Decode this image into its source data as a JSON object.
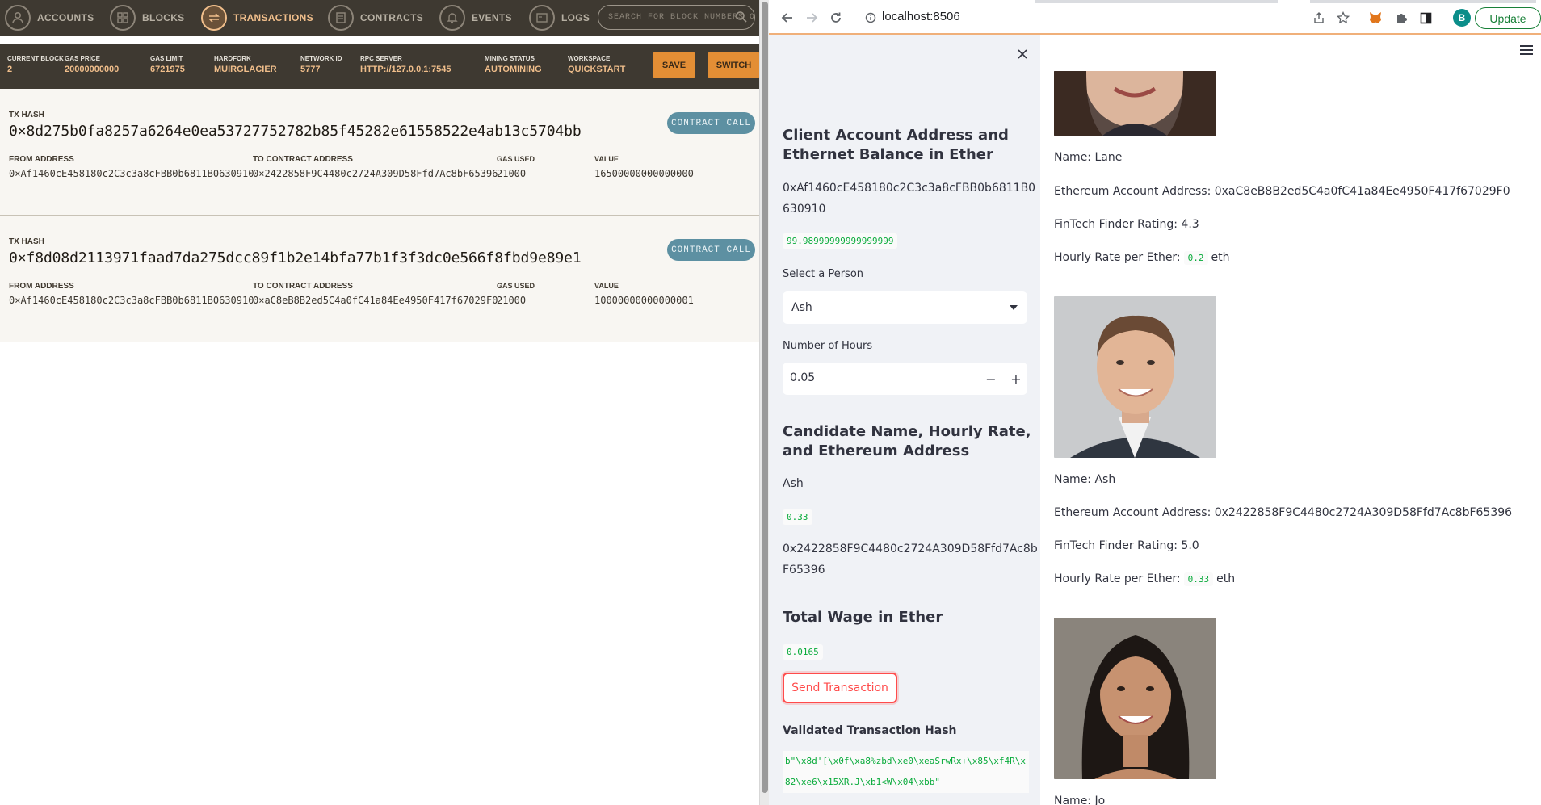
{
  "ganache": {
    "nav": [
      {
        "label": "ACCOUNTS",
        "icon": "user-icon",
        "active": false
      },
      {
        "label": "BLOCKS",
        "icon": "blocks-icon",
        "active": false
      },
      {
        "label": "TRANSACTIONS",
        "icon": "transactions-icon",
        "active": true
      },
      {
        "label": "CONTRACTS",
        "icon": "contracts-icon",
        "active": false
      },
      {
        "label": "EVENTS",
        "icon": "bell-icon",
        "active": false
      },
      {
        "label": "LOGS",
        "icon": "logs-icon",
        "active": false
      }
    ],
    "search_placeholder": "SEARCH FOR BLOCK NUMBERS OR TX HASHES",
    "info": {
      "current_block": {
        "label": "CURRENT BLOCK",
        "value": "2"
      },
      "gas_price": {
        "label": "GAS PRICE",
        "value": "20000000000"
      },
      "gas_limit": {
        "label": "GAS LIMIT",
        "value": "6721975"
      },
      "hardfork": {
        "label": "HARDFORK",
        "value": "MUIRGLACIER"
      },
      "network_id": {
        "label": "NETWORK ID",
        "value": "5777"
      },
      "rpc_server": {
        "label": "RPC SERVER",
        "value": "HTTP://127.0.0.1:7545"
      },
      "mining_status": {
        "label": "MINING STATUS",
        "value": "AUTOMINING"
      },
      "workspace": {
        "label": "WORKSPACE",
        "value": "QUICKSTART"
      }
    },
    "save_label": "SAVE",
    "switch_label": "SWITCH",
    "labels": {
      "tx_hash": "TX HASH",
      "from": "FROM ADDRESS",
      "to": "TO CONTRACT ADDRESS",
      "gas_used": "GAS USED",
      "value": "VALUE"
    },
    "transactions": [
      {
        "hash": "0×8d275b0fa8257a6264e0ea53727752782b85f45282e61558522e4ab13c5704bb",
        "badge": "CONTRACT CALL",
        "from": "0×Af1460cE458180c2C3c3a8cFBB0b6811B0630910",
        "to": "0×2422858F9C4480c2724A309D58Ffd7Ac8bF65396",
        "gas_used": "21000",
        "value": "16500000000000000"
      },
      {
        "hash": "0×f8d08d2113971faad7da275dcc89f1b2e14bfa77b1f3f3dc0e566f8fbd9e89e1",
        "badge": "CONTRACT CALL",
        "from": "0×Af1460cE458180c2C3c3a8cFBB0b6811B0630910",
        "to": "0×aC8eB8B2ed5C4a0fC41a84Ee4950F417f67029F0",
        "gas_used": "21000",
        "value": "10000000000000001"
      }
    ]
  },
  "browser": {
    "url": "localhost:8506",
    "avatar_letter": "B",
    "update_label": "Update"
  },
  "sidebar": {
    "client_heading": "Client Account Address and Ethernet Balance in Ether",
    "client_address": "0xAf1460cE458180c2C3c3a8cFBB0b6811B0630910",
    "client_balance": "99.98999999999999999",
    "select_label": "Select a Person",
    "selected_person": "Ash",
    "hours_label": "Number of Hours",
    "hours_value": "0.05",
    "candidate_heading": "Candidate Name, Hourly Rate, and Ethereum Address",
    "candidate_name": "Ash",
    "candidate_rate": "0.33",
    "candidate_address": "0x2422858F9C4480c2724A309D58Ffd7Ac8bF65396",
    "wage_heading": "Total Wage in Ether",
    "wage_value": "0.0165",
    "send_label": "Send Transaction",
    "validated_heading": "Validated Transaction Hash",
    "validated_hash": "b\"\\x8d'[\\x0f\\xa8%zbd\\xe0\\xeaSrwRx+\\x85\\xf4R\\x82\\xe6\\x15XR.J\\xb1<W\\x04\\xbb\""
  },
  "main": {
    "candidates": [
      {
        "name_line": "Name: Lane",
        "address_line": "Ethereum Account Address: 0xaC8eB8B2ed5C4a0fC41a84Ee4950F417f67029F0",
        "rating_line": "FinTech Finder Rating: 4.3",
        "rate_label": "Hourly Rate per Ether:",
        "rate": "0.2",
        "rate_unit": "eth"
      },
      {
        "name_line": "Name: Ash",
        "address_line": "Ethereum Account Address: 0x2422858F9C4480c2724A309D58Ffd7Ac8bF65396",
        "rating_line": "FinTech Finder Rating: 5.0",
        "rate_label": "Hourly Rate per Ether:",
        "rate": "0.33",
        "rate_unit": "eth"
      },
      {
        "name_line": "Name: Jo"
      }
    ]
  }
}
